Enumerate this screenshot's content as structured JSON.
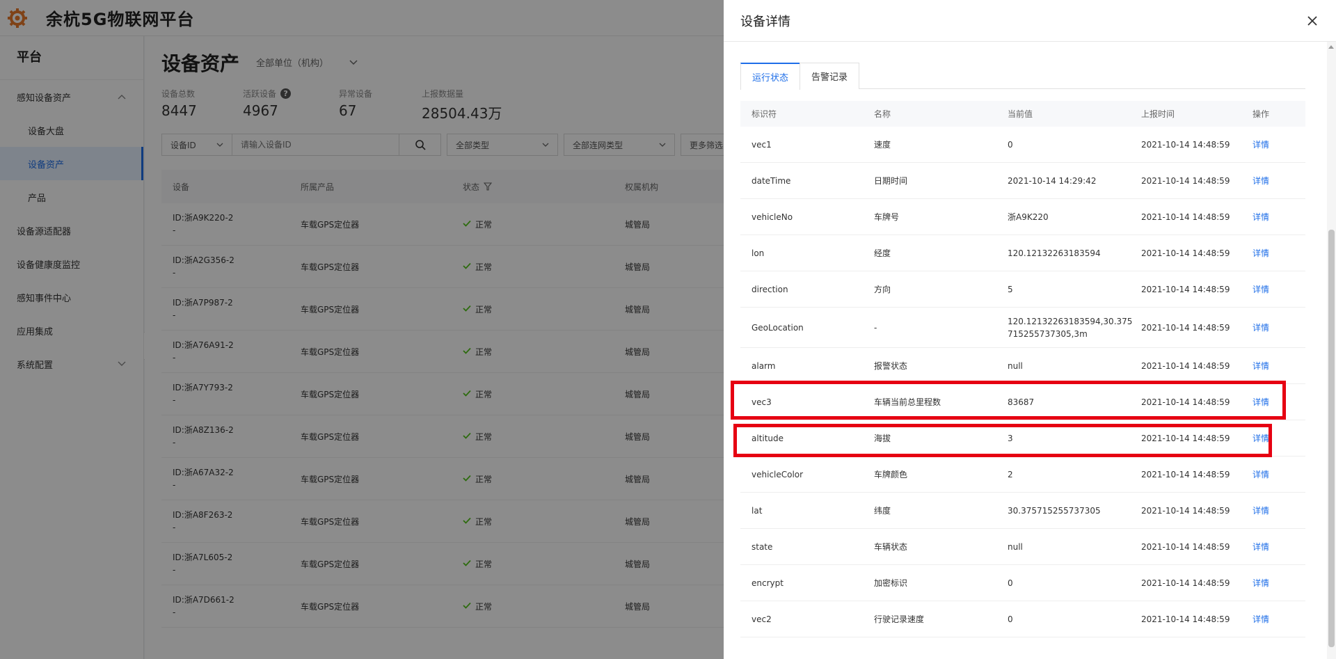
{
  "app": {
    "title": "余杭5G物联网平台"
  },
  "sidebar": {
    "header": "平台",
    "items": [
      {
        "label": "感知设备资产",
        "type": "group",
        "expanded": true
      },
      {
        "label": "设备大盘",
        "type": "sub"
      },
      {
        "label": "设备资产",
        "type": "sub",
        "active": true
      },
      {
        "label": "产品",
        "type": "sub"
      },
      {
        "label": "设备源适配器",
        "type": "item"
      },
      {
        "label": "设备健康度监控",
        "type": "item"
      },
      {
        "label": "感知事件中心",
        "type": "item"
      },
      {
        "label": "应用集成",
        "type": "item"
      },
      {
        "label": "系统配置",
        "type": "group",
        "expanded": false
      }
    ]
  },
  "main": {
    "title": "设备资产",
    "org_select": "全部单位（机构）",
    "stats": [
      {
        "label": "设备总数",
        "value": "8447"
      },
      {
        "label": "活跃设备",
        "value": "4967",
        "has_help": true
      },
      {
        "label": "异常设备",
        "value": "67"
      },
      {
        "label": "上报数据量",
        "value": "28504.43万"
      }
    ],
    "filters": {
      "id_select": "设备ID",
      "search_placeholder": "请输入设备ID",
      "type_select": "全部类型",
      "net_select": "全部连网类型",
      "more": "更多筛选"
    },
    "table": {
      "columns": [
        "设备",
        "所属产品",
        "状态",
        "权属机构"
      ],
      "rows": [
        {
          "id": "ID:浙A9K220-2",
          "sub": "-",
          "product": "车载GPS定位器",
          "status": "正常",
          "org": "城管局"
        },
        {
          "id": "ID:浙A2G356-2",
          "sub": "-",
          "product": "车载GPS定位器",
          "status": "正常",
          "org": "城管局"
        },
        {
          "id": "ID:浙A7P987-2",
          "sub": "-",
          "product": "车载GPS定位器",
          "status": "正常",
          "org": "城管局"
        },
        {
          "id": "ID:浙A76A91-2",
          "sub": "-",
          "product": "车载GPS定位器",
          "status": "正常",
          "org": "城管局"
        },
        {
          "id": "ID:浙A7Y793-2",
          "sub": "-",
          "product": "车载GPS定位器",
          "status": "正常",
          "org": "城管局"
        },
        {
          "id": "ID:浙A8Z136-2",
          "sub": "-",
          "product": "车载GPS定位器",
          "status": "正常",
          "org": "城管局"
        },
        {
          "id": "ID:浙A67A32-2",
          "sub": "-",
          "product": "车载GPS定位器",
          "status": "正常",
          "org": "城管局"
        },
        {
          "id": "ID:浙A8F263-2",
          "sub": "-",
          "product": "车载GPS定位器",
          "status": "正常",
          "org": "城管局"
        },
        {
          "id": "ID:浙A7L605-2",
          "sub": "-",
          "product": "车载GPS定位器",
          "status": "正常",
          "org": "城管局"
        },
        {
          "id": "ID:浙A7D661-2",
          "sub": "-",
          "product": "车载GPS定位器",
          "status": "正常",
          "org": "城管局"
        }
      ]
    }
  },
  "drawer": {
    "title": "设备详情",
    "tabs": [
      {
        "label": "运行状态",
        "active": true
      },
      {
        "label": "告警记录",
        "active": false
      }
    ],
    "columns": [
      "标识符",
      "名称",
      "当前值",
      "上报时间",
      "操作"
    ],
    "rows": [
      {
        "key": "vec1",
        "name": "速度",
        "value": "0",
        "time": "2021-10-14 14:48:59",
        "action": "详情"
      },
      {
        "key": "dateTime",
        "name": "日期时间",
        "value": "2021-10-14 14:29:42",
        "time": "2021-10-14 14:48:59",
        "action": "详情"
      },
      {
        "key": "vehicleNo",
        "name": "车牌号",
        "value": "浙A9K220",
        "time": "2021-10-14 14:48:59",
        "action": "详情"
      },
      {
        "key": "lon",
        "name": "经度",
        "value": "120.12132263183594",
        "time": "2021-10-14 14:48:59",
        "action": "详情"
      },
      {
        "key": "direction",
        "name": "方向",
        "value": "5",
        "time": "2021-10-14 14:48:59",
        "action": "详情"
      },
      {
        "key": "GeoLocation",
        "name": "-",
        "value": "120.12132263183594,30.375715255737305,3m",
        "time": "2021-10-14 14:48:59",
        "action": "详情"
      },
      {
        "key": "alarm",
        "name": "报警状态",
        "value": "null",
        "time": "2021-10-14 14:48:59",
        "action": "详情"
      },
      {
        "key": "vec3",
        "name": "车辆当前总里程数",
        "value": "83687",
        "time": "2021-10-14 14:48:59",
        "action": "详情",
        "highlighted": true
      },
      {
        "key": "altitude",
        "name": "海拔",
        "value": "3",
        "time": "2021-10-14 14:48:59",
        "action": "详情",
        "highlighted": true
      },
      {
        "key": "vehicleColor",
        "name": "车牌颜色",
        "value": "2",
        "time": "2021-10-14 14:48:59",
        "action": "详情"
      },
      {
        "key": "lat",
        "name": "纬度",
        "value": "30.375715255737305",
        "time": "2021-10-14 14:48:59",
        "action": "详情"
      },
      {
        "key": "state",
        "name": "车辆状态",
        "value": "null",
        "time": "2021-10-14 14:48:59",
        "action": "详情"
      },
      {
        "key": "encrypt",
        "name": "加密标识",
        "value": "0",
        "time": "2021-10-14 14:48:59",
        "action": "详情"
      },
      {
        "key": "vec2",
        "name": "行驶记录速度",
        "value": "0",
        "time": "2021-10-14 14:48:59",
        "action": "详情"
      }
    ]
  },
  "colors": {
    "accent": "#1e6ee8",
    "success": "#52c41a",
    "highlight": "#e60012",
    "logo": "#e8792a"
  }
}
